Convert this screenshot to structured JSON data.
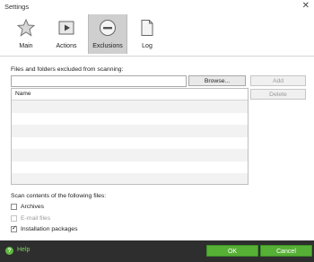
{
  "window": {
    "title": "Settings",
    "close_glyph": "✕"
  },
  "tabs": [
    {
      "label": "Main",
      "icon": "star-icon"
    },
    {
      "label": "Actions",
      "icon": "play-icon"
    },
    {
      "label": "Exclusions",
      "icon": "minus-circle-icon",
      "active": true
    },
    {
      "label": "Log",
      "icon": "document-icon"
    }
  ],
  "exclusions": {
    "section_label": "Files and folders excluded from scanning:",
    "path_value": "",
    "browse_label": "Browse...",
    "add_label": "Add",
    "delete_label": "Delete",
    "list_header": "Name"
  },
  "scan": {
    "section_label": "Scan contents of the following files:",
    "options": [
      {
        "label": "Archives",
        "checked": false,
        "enabled": true
      },
      {
        "label": "E-mail files",
        "checked": false,
        "enabled": false
      },
      {
        "label": "Installation packages",
        "checked": true,
        "enabled": true
      }
    ]
  },
  "footer": {
    "help_glyph": "?",
    "help_label": "Help",
    "ok_label": "OK",
    "cancel_label": "Cancel"
  },
  "colors": {
    "accent_green": "#57b036",
    "footer_bg": "#2e2e2e",
    "active_tab_bg": "#cfcfcf"
  }
}
